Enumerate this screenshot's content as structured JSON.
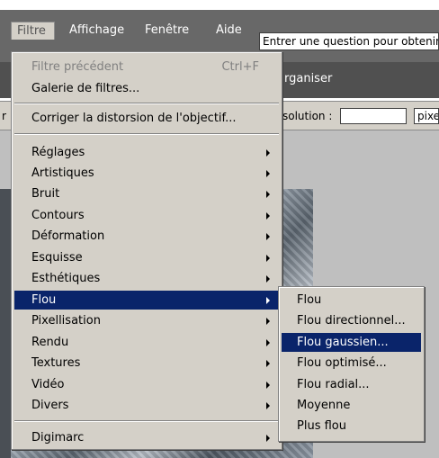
{
  "menubar": {
    "items": [
      "Filtre",
      "Affichage",
      "Fenêtre",
      "Aide"
    ],
    "help_text": "Entrer une question pour obtenir de l'aide"
  },
  "toolbar": {
    "organiser_label": "rganiser",
    "resolution_label": "solution :",
    "resolution_value": "",
    "unit": "pixels/pouce",
    "left_sliver": "r"
  },
  "filter_menu": {
    "top_items": [
      {
        "label": "Filtre précédent",
        "shortcut": "Ctrl+F",
        "disabled": true
      },
      {
        "label": "Galerie de filtres...",
        "shortcut": ""
      }
    ],
    "lens_item": "Corriger la distorsion de l'objectif...",
    "category_items": [
      "Réglages",
      "Artistiques",
      "Bruit",
      "Contours",
      "Déformation",
      "Esquisse",
      "Esthétiques",
      "Flou",
      "Pixellisation",
      "Rendu",
      "Textures",
      "Vidéo",
      "Divers"
    ],
    "highlighted": "Flou",
    "bottom_item": "Digimarc"
  },
  "blur_submenu": {
    "items": [
      "Flou",
      "Flou directionnel...",
      "Flou gaussien...",
      "Flou optimisé...",
      "Flou radial...",
      "Moyenne",
      "Plus flou"
    ],
    "highlighted": "Flou gaussien..."
  },
  "colors": {
    "menu_bg": "#d4d0c8",
    "highlight": "#0a246a",
    "menubar_bg": "#686868",
    "workspace": "#bfbfbf"
  }
}
